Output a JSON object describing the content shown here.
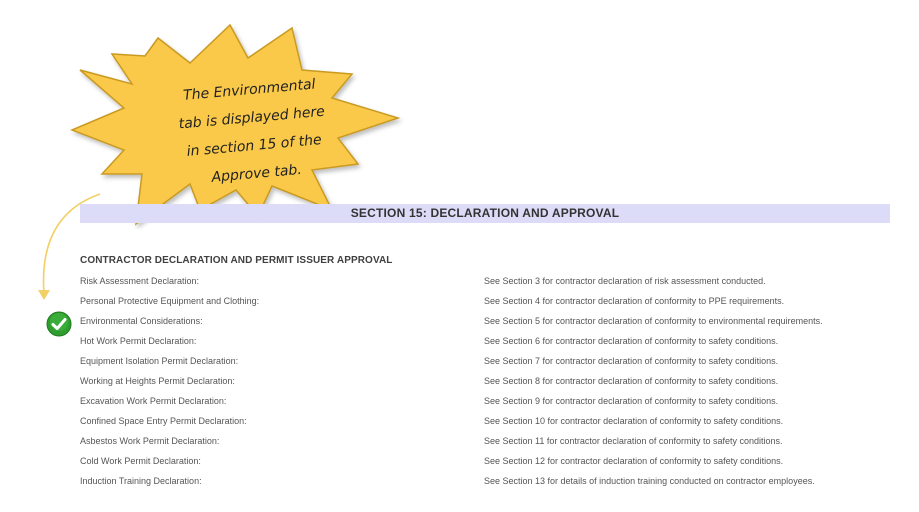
{
  "callout": {
    "lines": [
      "The Environmental",
      "tab is displayed here",
      "in section 15 of the",
      "Approve tab."
    ]
  },
  "section": {
    "title": "SECTION 15: DECLARATION AND APPROVAL"
  },
  "subheading": "CONTRACTOR DECLARATION AND PERMIT ISSUER APPROVAL",
  "declarations": [
    {
      "label": "Risk Assessment Declaration:",
      "value": "See Section 3 for contractor declaration of risk assessment conducted."
    },
    {
      "label": "Personal Protective Equipment and Clothing:",
      "value": "See Section 4 for contractor declaration of conformity to PPE requirements."
    },
    {
      "label": "Environmental Considerations:",
      "value": "See Section 5 for contractor declaration of conformity to environmental requirements."
    },
    {
      "label": "Hot Work Permit Declaration:",
      "value": "See Section 6 for contractor declaration of conformity to safety conditions."
    },
    {
      "label": "Equipment Isolation Permit Declaration:",
      "value": "See Section 7 for contractor declaration of conformity to safety conditions."
    },
    {
      "label": "Working at Heights Permit Declaration:",
      "value": "See Section 8 for contractor declaration of conformity to safety conditions."
    },
    {
      "label": "Excavation Work Permit Declaration:",
      "value": "See Section 9 for contractor declaration of conformity to safety conditions."
    },
    {
      "label": "Confined Space Entry Permit Declaration:",
      "value": "See Section 10 for contractor declaration of conformity to safety conditions."
    },
    {
      "label": "Asbestos Work Permit Declaration:",
      "value": "See Section 11 for contractor declaration of conformity to safety conditions."
    },
    {
      "label": "Cold Work Permit Declaration:",
      "value": "See Section 12 for contractor declaration of conformity to safety conditions."
    },
    {
      "label": "Induction Training Declaration:",
      "value": "See Section 13 for details of induction training conducted on contractor employees."
    }
  ],
  "colors": {
    "header_band": "#dcdcf8",
    "callout_fill": "#fbc94a",
    "callout_stroke": "#c99a20",
    "check_fill": "#2f9e2f"
  },
  "icons": {
    "callout": "starburst-callout-icon",
    "check": "check-circle-icon",
    "arrow": "curved-arrow-icon"
  }
}
